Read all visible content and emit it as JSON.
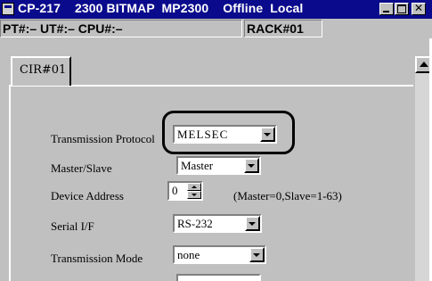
{
  "window": {
    "title": "CP-217    2300 BITMAP  MP2300    Offline  Local",
    "controls": {
      "minimize_icon": "minimize-icon",
      "maximize_icon": "maximize-icon",
      "close_icon": "close-icon"
    }
  },
  "status": {
    "pt_ut_cpu": "PT#:– UT#:– CPU#:–",
    "rack": "RACK#01"
  },
  "tabs": [
    {
      "label": "CIR#01",
      "selected": true
    }
  ],
  "form": {
    "transmission_protocol": {
      "label": "Transmission Protocol",
      "value": "MELSEC"
    },
    "master_slave": {
      "label": "Master/Slave",
      "value": "Master"
    },
    "device_address": {
      "label": "Device Address",
      "value": "0",
      "hint": "(Master=0,Slave=1-63)"
    },
    "serial_if": {
      "label": "Serial I/F",
      "value": "RS-232"
    },
    "transmission_mode": {
      "label": "Transmission Mode",
      "value": "none"
    }
  },
  "colors": {
    "titlebar": "#0a0a8c",
    "window_bg": "#c0c0c0",
    "highlight": "#000000"
  }
}
